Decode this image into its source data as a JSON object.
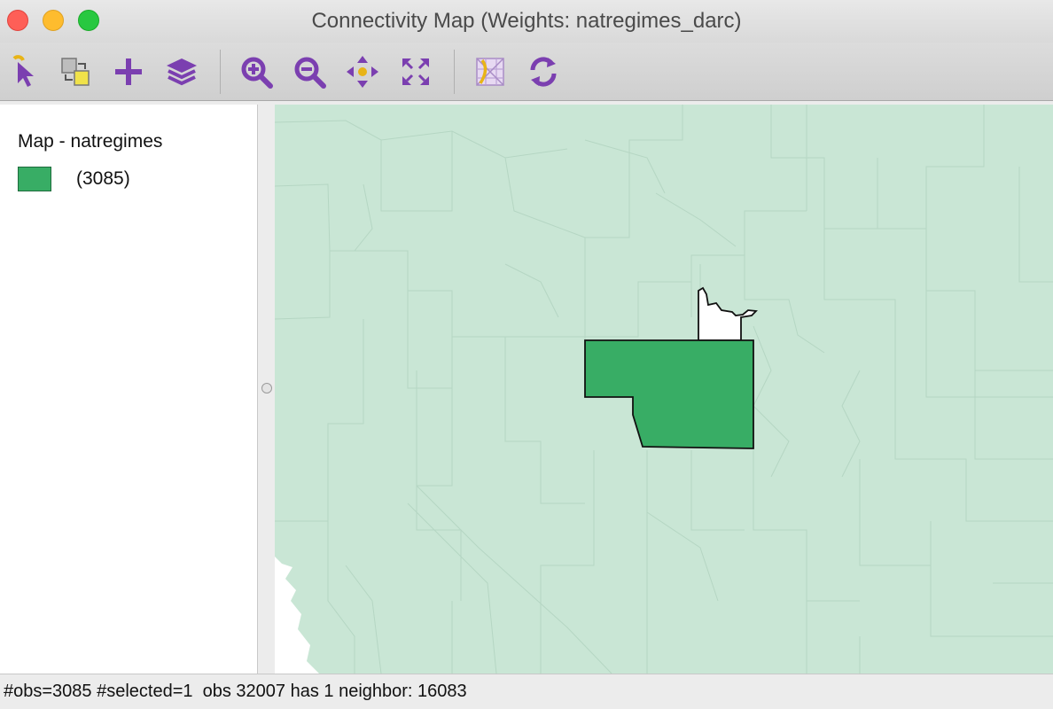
{
  "window": {
    "title": "Connectivity Map (Weights: natregimes_darc)"
  },
  "toolbar": {
    "tools": [
      {
        "name": "select-tool",
        "icon": "pointer-icon"
      },
      {
        "name": "selection-mode-tool",
        "icon": "selection-mode-icon"
      },
      {
        "name": "add-tool",
        "icon": "plus-icon"
      },
      {
        "name": "layers-tool",
        "icon": "layers-icon"
      },
      {
        "name": "zoom-in-tool",
        "icon": "zoom-in-icon"
      },
      {
        "name": "zoom-out-tool",
        "icon": "zoom-out-icon"
      },
      {
        "name": "pan-tool",
        "icon": "pan-icon"
      },
      {
        "name": "full-extent-tool",
        "icon": "full-extent-icon"
      },
      {
        "name": "basemap-tool",
        "icon": "basemap-icon"
      },
      {
        "name": "refresh-tool",
        "icon": "refresh-icon"
      }
    ],
    "accent_color": "#7b3fb0"
  },
  "legend": {
    "title": "Map - natregimes",
    "items": [
      {
        "label": "(3085)",
        "color": "#38ad65"
      }
    ]
  },
  "map": {
    "background_color": "#c9e6d5",
    "boundary_color": "#b5d6c3",
    "selected_color": "#38ad65",
    "neighbor_color": "#ffffff"
  },
  "status": {
    "text": "#obs=3085 #selected=1  obs 32007 has 1 neighbor: 16083"
  }
}
